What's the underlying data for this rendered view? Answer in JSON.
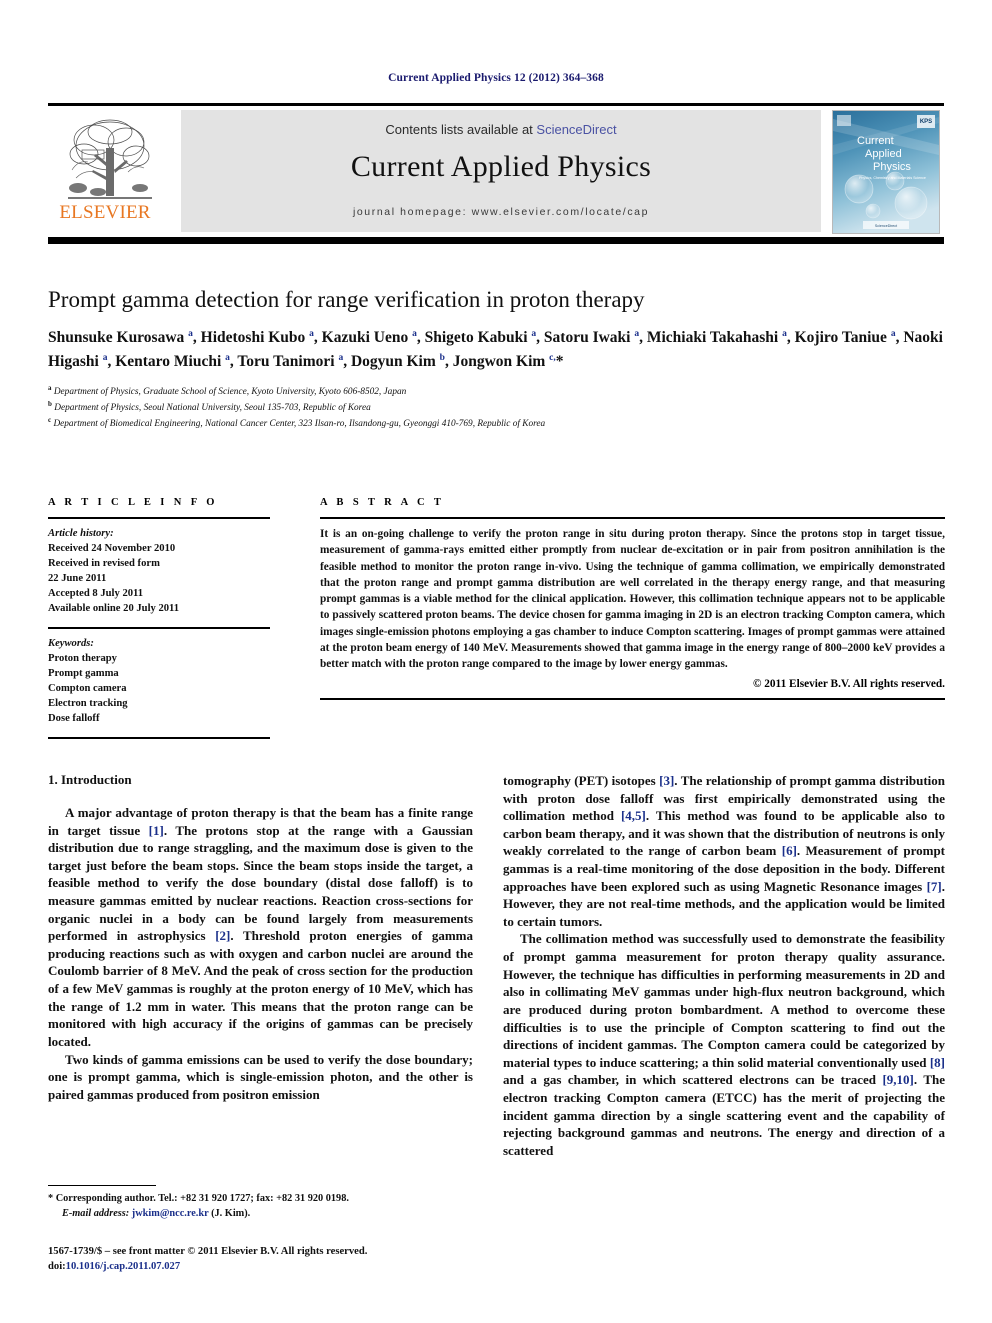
{
  "running_head": "Current Applied Physics 12 (2012) 364–368",
  "masthead": {
    "publisher_name": "ELSEVIER",
    "contents_prefix": "Contents lists available at ",
    "sciencedirect_label": "ScienceDirect",
    "journal_title": "Current Applied Physics",
    "homepage": "journal homepage: www.elsevier.com/locate/cap",
    "cover": {
      "line1": "Current",
      "line2": "Applied",
      "line3": "Physics",
      "subtitle": "Physics, Chemistry and Materials Science",
      "badge": "KPS",
      "footer": "ScienceDirect"
    },
    "link_color": "#4a52a3",
    "publisher_color": "#e87722"
  },
  "article": {
    "title": "Prompt gamma detection for range verification in proton therapy",
    "authors_html": "Shunsuke Kurosawa <sup>a</sup>, Hidetoshi Kubo <sup>a</sup>, Kazuki Ueno <sup>a</sup>, Shigeto Kabuki <sup>a</sup>, Satoru Iwaki <sup>a</sup>, Michiaki Takahashi <sup>a</sup>, Kojiro Taniue <sup>a</sup>, Naoki Higashi <sup>a</sup>, Kentaro Miuchi <sup>a</sup>, Toru Tanimori <sup>a</sup>, Dogyun Kim <sup>b</sup>, Jongwon Kim <sup>c,</sup>*",
    "affiliations": [
      {
        "marker": "a",
        "text": "Department of Physics, Graduate School of Science, Kyoto University, Kyoto 606-8502, Japan"
      },
      {
        "marker": "b",
        "text": "Department of Physics, Seoul National University, Seoul 135-703, Republic of Korea"
      },
      {
        "marker": "c",
        "text": "Department of Biomedical Engineering, National Cancer Center, 323 Ilsan-ro, Ilsandong-gu, Gyeonggi 410-769, Republic of Korea"
      }
    ]
  },
  "article_info": {
    "heading": "A R T I C L E  I N F O",
    "history_label": "Article history:",
    "history": [
      "Received 24 November 2010",
      "Received in revised form",
      "22 June 2011",
      "Accepted 8 July 2011",
      "Available online 20 July 2011"
    ],
    "keywords_label": "Keywords:",
    "keywords": [
      "Proton therapy",
      "Prompt gamma",
      "Compton camera",
      "Electron tracking",
      "Dose falloff"
    ]
  },
  "abstract": {
    "heading": "A B S T R A C T",
    "text": "It is an on-going challenge to verify the proton range in situ during proton therapy. Since the protons stop in target tissue, measurement of gamma-rays emitted either promptly from nuclear de-excitation or in pair from positron annihilation is the feasible method to monitor the proton range in-vivo. Using the technique of gamma collimation, we empirically demonstrated that the proton range and prompt gamma distribution are well correlated in the therapy energy range, and that measuring prompt gammas is a viable method for the clinical application. However, this collimation technique appears not to be applicable to passively scattered proton beams. The device chosen for gamma imaging in 2D is an electron tracking Compton camera, which images single-emission photons employing a gas chamber to induce Compton scattering. Images of prompt gammas were attained at the proton beam energy of 140 MeV. Measurements showed that gamma image in the energy range of 800–2000 keV provides a better match with the proton range compared to the image by lower energy gammas.",
    "copyright": "© 2011 Elsevier B.V. All rights reserved."
  },
  "body": {
    "section_heading": "1. Introduction",
    "left_paragraphs": [
      "A major advantage of proton therapy is that the beam has a finite range in target tissue [1]. The protons stop at the range with a Gaussian distribution due to range straggling, and the maximum dose is given to the target just before the beam stops. Since the beam stops inside the target, a feasible method to verify the dose boundary (distal dose falloff) is to measure gammas emitted by nuclear reactions. Reaction cross-sections for organic nuclei in a body can be found largely from measurements performed in astrophysics [2]. Threshold proton energies of gamma producing reactions such as with oxygen and carbon nuclei are around the Coulomb barrier of 8 MeV. And the peak of cross section for the production of a few MeV gammas is roughly at the proton energy of 10 MeV, which has the range of 1.2 mm in water. This means that the proton range can be monitored with high accuracy if the origins of gammas can be precisely located.",
      "Two kinds of gamma emissions can be used to verify the dose boundary; one is prompt gamma, which is single-emission photon, and the other is paired gammas produced from positron emission"
    ],
    "right_paragraphs": [
      "tomography (PET) isotopes [3]. The relationship of prompt gamma distribution with proton dose falloff was first empirically demonstrated using the collimation method [4,5]. This method was found to be applicable also to carbon beam therapy, and it was shown that the distribution of neutrons is only weakly correlated to the range of carbon beam [6]. Measurement of prompt gammas is a real-time monitoring of the dose deposition in the body. Different approaches have been explored such as using Magnetic Resonance images [7]. However, they are not real-time methods, and the application would be limited to certain tumors.",
      "The collimation method was successfully used to demonstrate the feasibility of prompt gamma measurement for proton therapy quality assurance. However, the technique has difficulties in performing measurements in 2D and also in collimating MeV gammas under high-flux neutron background, which are produced during proton bombardment. A method to overcome these difficulties is to use the principle of Compton scattering to find out the directions of incident gammas. The Compton camera could be categorized by material types to induce scattering; a thin solid material conventionally used [8] and a gas chamber, in which scattered electrons can be traced [9,10]. The electron tracking Compton camera (ETCC) has the merit of projecting the incident gamma direction by a single scattering event and the capability of rejecting background gammas and neutrons. The energy and direction of a scattered"
    ]
  },
  "footnote": {
    "corresponding": "* Corresponding author. Tel.: +82 31 920 1727; fax: +82 31 920 0198.",
    "email_label": "E-mail address:",
    "email": "jwkim@ncc.re.kr",
    "email_suffix": "(J. Kim).",
    "issn_line": "1567-1739/$ – see front matter © 2011 Elsevier B.V. All rights reserved.",
    "doi_label": "doi:",
    "doi": "10.1016/j.cap.2011.07.027"
  }
}
